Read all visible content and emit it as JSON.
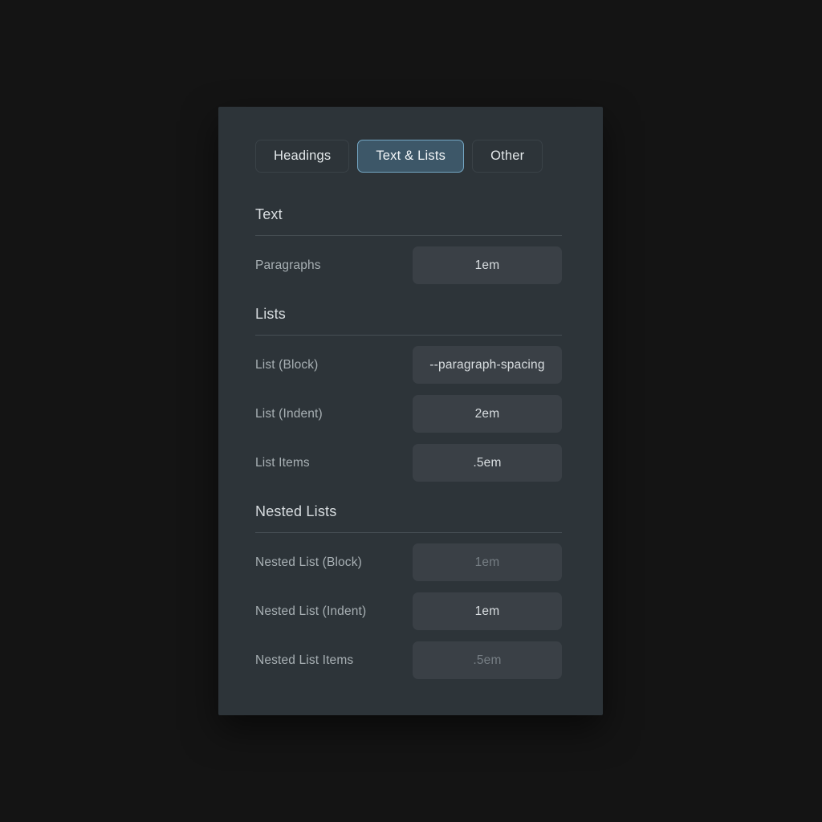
{
  "background_color": "#141414",
  "panel": {
    "background_color": "#2d3439"
  },
  "tabs": {
    "active_index": 1,
    "active_color": "#74a7c4",
    "items": [
      {
        "label": "Headings",
        "active": false
      },
      {
        "label": "Text & Lists",
        "active": true
      },
      {
        "label": "Other",
        "active": false
      }
    ]
  },
  "sections": [
    {
      "title": "Text",
      "rows": [
        {
          "label": "Paragraphs",
          "value": "1em",
          "placeholder": false
        }
      ]
    },
    {
      "title": "Lists",
      "rows": [
        {
          "label": "List (Block)",
          "value": "--paragraph-spacing",
          "placeholder": false
        },
        {
          "label": "List (Indent)",
          "value": "2em",
          "placeholder": false
        },
        {
          "label": "List Items",
          "value": ".5em",
          "placeholder": false
        }
      ]
    },
    {
      "title": "Nested Lists",
      "rows": [
        {
          "label": "Nested List (Block)",
          "value": "1em",
          "placeholder": true
        },
        {
          "label": "Nested List (Indent)",
          "value": "1em",
          "placeholder": false
        },
        {
          "label": "Nested List Items",
          "value": ".5em",
          "placeholder": true
        }
      ]
    }
  ]
}
